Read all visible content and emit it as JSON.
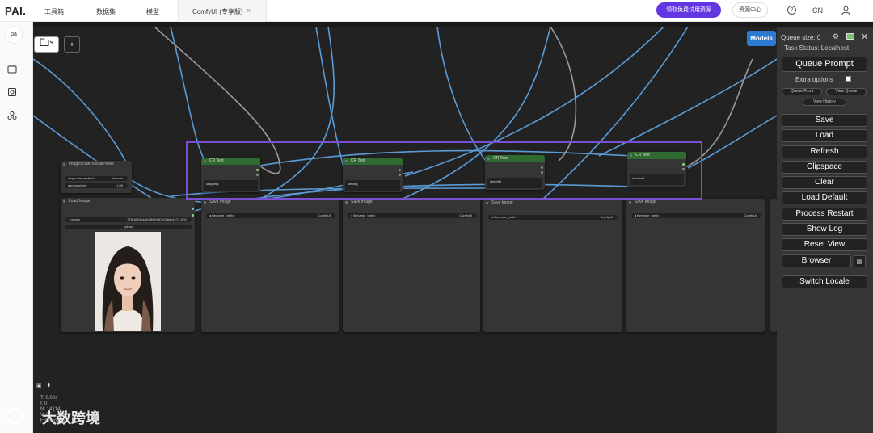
{
  "topbar": {
    "logo": "PAI.",
    "nav": [
      "工具箱",
      "数据集",
      "模型"
    ],
    "active_tab": "ComfyUI (专享版)",
    "tab_close": "×",
    "promo_button": "领取免费试用资源",
    "resource_button": "资源中心",
    "help": "?",
    "language": "CN"
  },
  "leftrail": {
    "badge": "pa"
  },
  "canvas": {
    "group_nodes": [
      {
        "title": "CR Text",
        "text": "laughing"
      },
      {
        "title": "CR Text",
        "text": "smiling"
      },
      {
        "title": "CR Text",
        "text": "cheerful"
      },
      {
        "title": "CR Text",
        "text": "shocked"
      }
    ],
    "scale_node": {
      "title": "ImageScaleToTotalPixels",
      "widgets": [
        {
          "name": "upscale_method",
          "value": "lanczos"
        },
        {
          "name": "megapixels",
          "value": "1.00"
        }
      ]
    },
    "load_image": {
      "title": "Load Image",
      "image_name": "image",
      "image_value": "77fb1684a4c8d3f4f5f9f7c018db4c71.JPG",
      "upload": "upload"
    },
    "save_nodes": [
      {
        "title": "Save Image",
        "prefix_label": "filename_prefix",
        "prefix_value": "ComfyUI"
      },
      {
        "title": "Save Image",
        "prefix_label": "filename_prefix",
        "prefix_value": "ComfyUI"
      },
      {
        "title": "Save Image",
        "prefix_label": "filename_prefix",
        "prefix_value": "ComfyUI"
      },
      {
        "title": "Save Image",
        "prefix_label": "filename_prefix",
        "prefix_value": "ComfyUI"
      }
    ],
    "toolbar_add": "+",
    "stats": [
      "T: 0.00s",
      "I: 0",
      "N: 14 [14]",
      "V: 35",
      "FPS: 59.88"
    ],
    "watermark": "大数跨境"
  },
  "panel": {
    "models_button": "Models",
    "queue_size": "Queue size: 0",
    "task_status": "Task Status: Localhost",
    "close": "✕",
    "queue_prompt": "Queue Prompt",
    "extra_options": "Extra options",
    "queue_front": "Queue Front",
    "view_queue": "View Queue",
    "view_history": "View History",
    "buttons": [
      "Save",
      "Load",
      "Refresh",
      "Clipspace",
      "Clear",
      "Load Default",
      "Process Restart",
      "Show Log",
      "Reset View",
      "Browser"
    ],
    "switch_locale": "Switch Locale"
  },
  "colors": {
    "accent": "#6236e0",
    "group_border": "#7b4fd4",
    "wire": "#5b9bd5",
    "node_header": "#2f6a30",
    "models": "#2b7bd3"
  }
}
